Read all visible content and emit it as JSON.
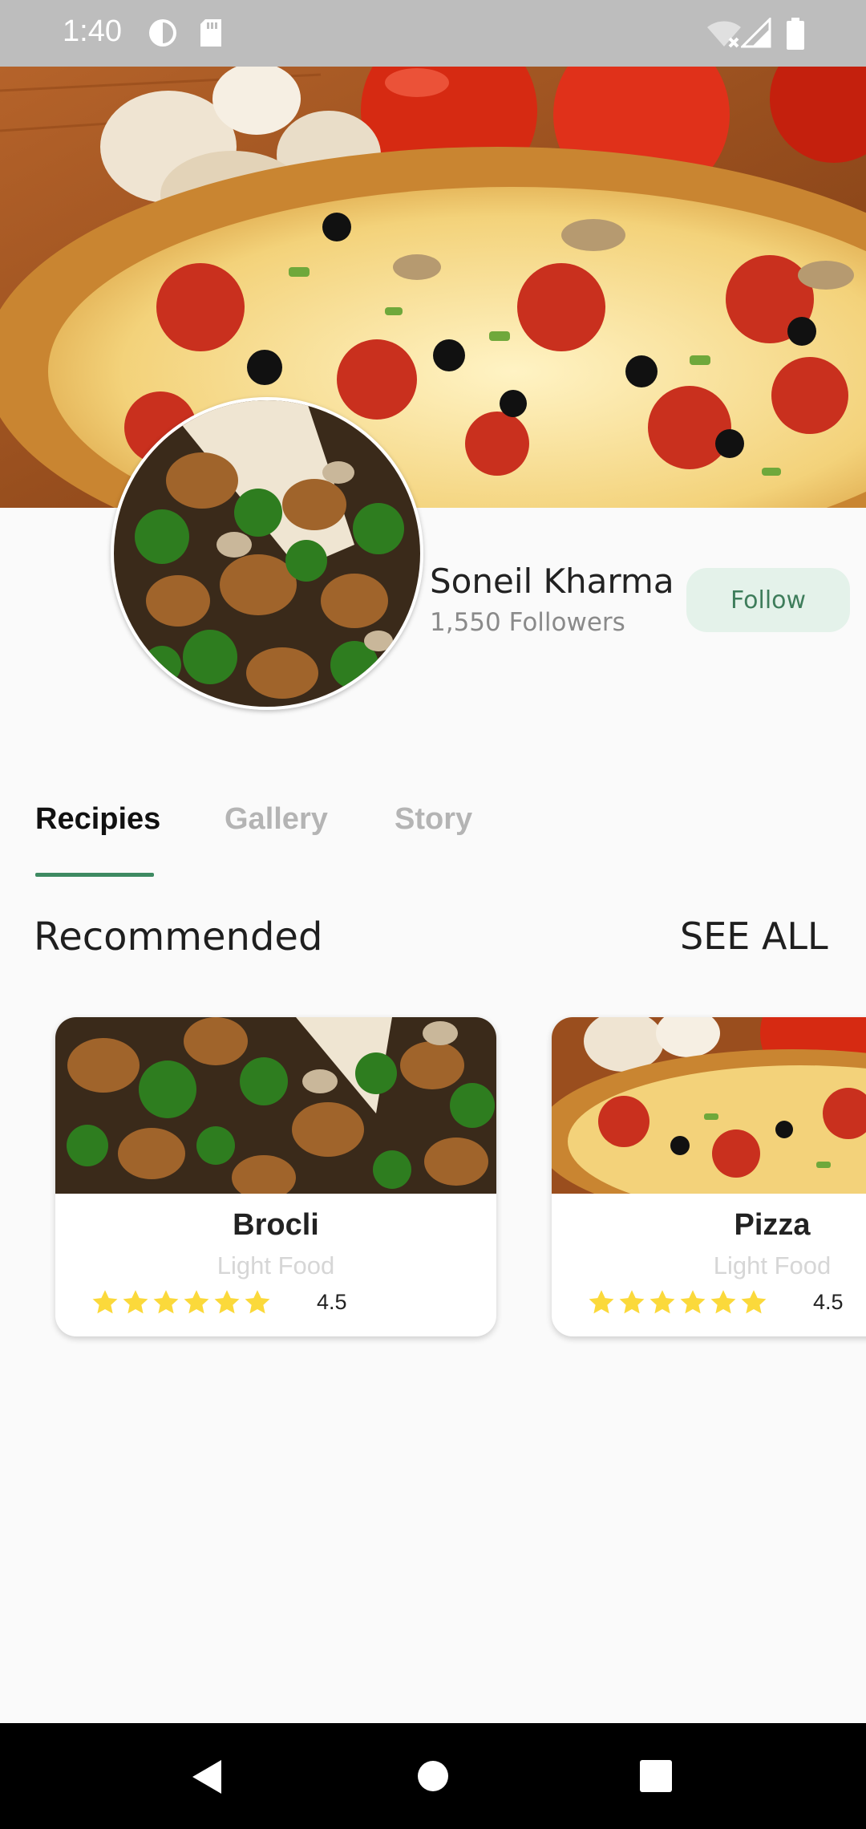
{
  "status_bar": {
    "time": "1:40"
  },
  "profile": {
    "name": "Soneil Kharma",
    "followers": "1,550 Followers",
    "follow_label": "Follow"
  },
  "tabs": [
    {
      "label": "Recipies",
      "active": true
    },
    {
      "label": "Gallery",
      "active": false
    },
    {
      "label": "Story",
      "active": false
    }
  ],
  "section": {
    "title": "Recommended",
    "see_all": "SEE ALL"
  },
  "cards": [
    {
      "title": "Brocli",
      "subtitle": "Light Food",
      "rating": "4.5",
      "stars": 6
    },
    {
      "title": "Pizza",
      "subtitle": "Light Food",
      "rating": "4.5",
      "stars": 6
    }
  ],
  "colors": {
    "accent": "#3e8a62",
    "follow_bg": "#e4f2ea",
    "star": "#fbd93b",
    "status_bar": "#bdbdbd"
  }
}
